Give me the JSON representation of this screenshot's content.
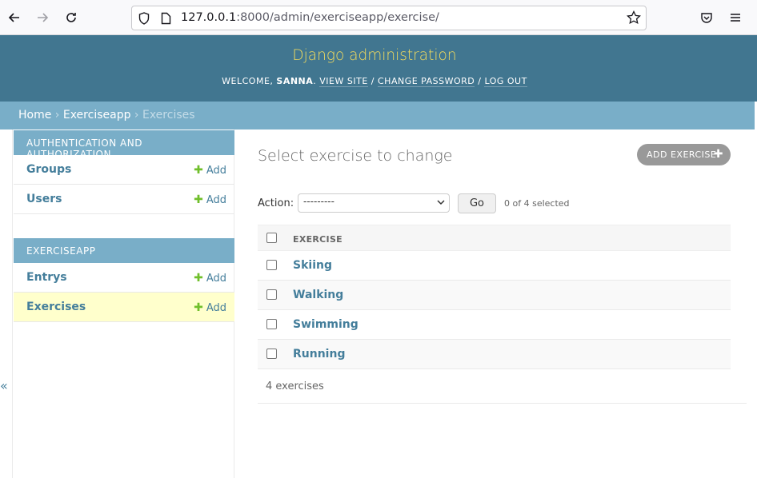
{
  "browser": {
    "url_host": "127.0.0.1",
    "url_path": ":8000/admin/exerciseapp/exercise/"
  },
  "header": {
    "branding": "Django administration",
    "welcome": "Welcome,",
    "username": "sanna",
    "view_site": "View site",
    "change_password": "Change password",
    "log_out": "Log out",
    "separator": "/"
  },
  "breadcrumbs": {
    "home": "Home",
    "app": "Exerciseapp",
    "current": "Exercises",
    "sep": "›"
  },
  "sidebar": {
    "modules": [
      {
        "caption": "Authentication and Authorization",
        "rows": [
          {
            "label": "Groups",
            "add": "Add"
          },
          {
            "label": "Users",
            "add": "Add"
          }
        ]
      },
      {
        "caption": "Exerciseapp",
        "rows": [
          {
            "label": "Entrys",
            "add": "Add"
          },
          {
            "label": "Exercises",
            "add": "Add"
          }
        ]
      }
    ],
    "collapse": "«"
  },
  "content": {
    "title": "Select exercise to change",
    "add_button": "Add exercise",
    "action_label": "Action:",
    "action_value": "---------",
    "go": "Go",
    "selected": "0 of 4 selected",
    "column": "Exercise",
    "rows": [
      "Skiing",
      "Walking",
      "Swimming",
      "Running"
    ],
    "count": "4 exercises"
  },
  "colors": {
    "header": "#417690",
    "breadcrumbs": "#79aec8",
    "branding": "#f5dd5d",
    "link": "#447e9b",
    "add_plus": "#70bf2b",
    "current_row": "#ffffcc"
  }
}
